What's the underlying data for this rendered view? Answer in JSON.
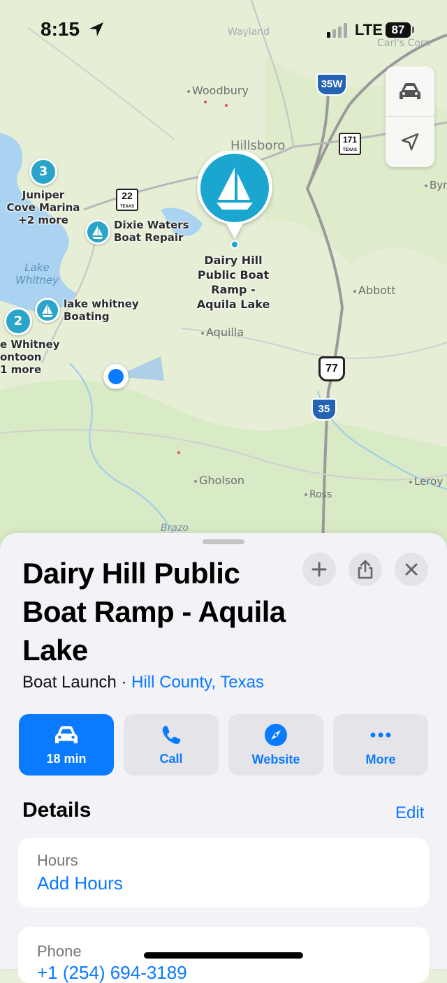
{
  "status_bar": {
    "time": "8:15",
    "network": "LTE",
    "battery": "87"
  },
  "map": {
    "towns": [
      "Woodbury",
      "Hillsboro",
      "Abbott",
      "Aquilla",
      "Gholson",
      "Ross",
      "Leroy",
      "Byr",
      "Carl's Corn",
      "Wayland",
      "Brazo"
    ],
    "lake": "Lake Whitney",
    "road_shields": {
      "i35w": "35W",
      "tx171": "171",
      "tx171_state": "TEXAS",
      "tx22": "22",
      "tx22_state": "TEXAS",
      "us77": "77",
      "i35": "35"
    },
    "clusters": [
      {
        "count": "3",
        "label": "Juniper Cove Marina +2 more"
      },
      {
        "count": "2",
        "label": "e Whitney ontoon 1 more"
      }
    ],
    "poi": [
      {
        "label": "Dixie Waters Boat Repair"
      },
      {
        "label": "lake whitney Boating"
      }
    ],
    "selected_pin_label": "Dairy Hill Public Boat Ramp - Aquila Lake",
    "cluster_labels": {
      "juniper_line1": "Juniper",
      "juniper_line2": "Cove Marina",
      "juniper_line3": "+2 more",
      "whitney_line1": "e Whitney",
      "whitney_line2": "ontoon",
      "whitney_line3": "1 more"
    },
    "poi_lines": {
      "dixie_line1": "Dixie Waters",
      "dixie_line2": "Boat Repair",
      "boating_line1": "lake whitney",
      "boating_line2": "Boating",
      "selected_line1": "Dairy Hill",
      "selected_line2": "Public Boat",
      "selected_line3": "Ramp -",
      "selected_line4": "Aquila Lake",
      "lake_line1": "Lake",
      "lake_line2": "Whitney"
    }
  },
  "place": {
    "title": "Dairy Hill Public Boat Ramp - Aquila Lake",
    "category": "Boat Launch",
    "separator": " · ",
    "region": "Hill County, Texas"
  },
  "actions": [
    {
      "label": "18 min",
      "icon": "car-icon"
    },
    {
      "label": "Call",
      "icon": "phone-icon"
    },
    {
      "label": "Website",
      "icon": "compass-icon"
    },
    {
      "label": "More",
      "icon": "ellipsis-icon"
    }
  ],
  "details": {
    "title": "Details",
    "edit": "Edit",
    "hours_key": "Hours",
    "hours_value": "Add Hours",
    "phone_key": "Phone",
    "phone_value": "+1 (254) 694-3189"
  },
  "colors": {
    "accent": "#0a7aff",
    "poi": "#2aa5c9",
    "sheet": "#f2f2f7"
  }
}
